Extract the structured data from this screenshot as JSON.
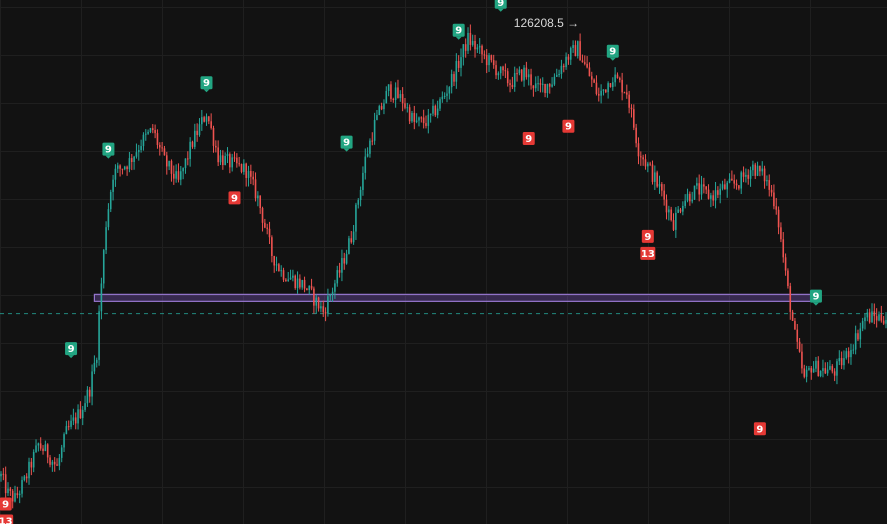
{
  "chart_data": {
    "type": "candlestick",
    "title": "",
    "xlabel": "",
    "ylabel": "",
    "ylim": [
      99000,
      128500
    ],
    "x_count": 380,
    "grid": true,
    "colors": {
      "background": "#121212",
      "grid": "#1f1f1f",
      "up": "#26a69a",
      "down": "#ef5350",
      "sell_marker": "#22a582",
      "buy_marker": "#e53935",
      "zone_fill": "#7e57c2",
      "zone_border": "#9575cd",
      "dashed_line": "#26a69a"
    },
    "anchors": [
      [
        0,
        101500
      ],
      [
        3,
        100500
      ],
      [
        6,
        100200
      ],
      [
        10,
        101200
      ],
      [
        16,
        103300
      ],
      [
        20,
        102800
      ],
      [
        24,
        102000
      ],
      [
        28,
        104000
      ],
      [
        34,
        105200
      ],
      [
        38,
        106500
      ],
      [
        41,
        108600
      ],
      [
        42,
        110800
      ],
      [
        45,
        116000
      ],
      [
        48,
        118800
      ],
      [
        55,
        119500
      ],
      [
        60,
        120600
      ],
      [
        65,
        121300
      ],
      [
        70,
        119500
      ],
      [
        76,
        118300
      ],
      [
        82,
        120600
      ],
      [
        88,
        122300
      ],
      [
        93,
        119800
      ],
      [
        98,
        119400
      ],
      [
        105,
        119000
      ],
      [
        110,
        117400
      ],
      [
        116,
        114200
      ],
      [
        120,
        113200
      ],
      [
        126,
        112700
      ],
      [
        130,
        112400
      ],
      [
        138,
        110900
      ],
      [
        145,
        113200
      ],
      [
        150,
        115200
      ],
      [
        156,
        119600
      ],
      [
        160,
        121600
      ],
      [
        166,
        123600
      ],
      [
        172,
        123000
      ],
      [
        177,
        121700
      ],
      [
        183,
        121800
      ],
      [
        190,
        123300
      ],
      [
        195,
        124800
      ],
      [
        200,
        126500
      ],
      [
        206,
        125600
      ],
      [
        212,
        124800
      ],
      [
        218,
        124000
      ],
      [
        224,
        124600
      ],
      [
        230,
        123600
      ],
      [
        236,
        124100
      ],
      [
        242,
        125400
      ],
      [
        247,
        126000
      ],
      [
        250,
        125000
      ],
      [
        256,
        123200
      ],
      [
        262,
        124400
      ],
      [
        268,
        123500
      ],
      [
        273,
        120200
      ],
      [
        278,
        119000
      ],
      [
        283,
        117700
      ],
      [
        288,
        116000
      ],
      [
        292,
        117300
      ],
      [
        298,
        117900
      ],
      [
        304,
        117500
      ],
      [
        310,
        118000
      ],
      [
        316,
        118300
      ],
      [
        322,
        119200
      ],
      [
        327,
        118600
      ],
      [
        332,
        117000
      ],
      [
        336,
        113000
      ],
      [
        340,
        109500
      ],
      [
        344,
        107000
      ],
      [
        347,
        107800
      ],
      [
        352,
        107600
      ],
      [
        357,
        107500
      ],
      [
        362,
        108400
      ],
      [
        366,
        109400
      ],
      [
        370,
        110600
      ]
    ],
    "zone": {
      "x_start": 40,
      "x_end": 380,
      "y_low": 111500,
      "y_high": 111900
    },
    "dashed_level": 110800,
    "high_label": {
      "text": "126208.5 →",
      "x_index": 247
    },
    "sell_markers": [
      {
        "label": "9",
        "x_index": 30,
        "y": 108200
      },
      {
        "label": "9",
        "x_index": 46,
        "y": 119600
      },
      {
        "label": "9",
        "x_index": 88,
        "y": 123400
      },
      {
        "label": "9",
        "x_index": 148,
        "y": 120000
      },
      {
        "label": "9",
        "x_index": 196,
        "y": 126400
      },
      {
        "label": "9",
        "x_index": 214,
        "y": 128000
      },
      {
        "label": "9",
        "x_index": 262,
        "y": 125200
      },
      {
        "label": "9",
        "x_index": 349,
        "y": 111200
      }
    ],
    "buy_markers": [
      {
        "labels": [
          "9",
          "13"
        ],
        "x_index": 2,
        "y": 100400
      },
      {
        "labels": [
          "9"
        ],
        "x_index": 100,
        "y": 117900
      },
      {
        "labels": [
          "9"
        ],
        "x_index": 226,
        "y": 121300
      },
      {
        "labels": [
          "9"
        ],
        "x_index": 243,
        "y": 122000
      },
      {
        "labels": [
          "9",
          "13"
        ],
        "x_index": 277,
        "y": 115700
      },
      {
        "labels": [
          "9"
        ],
        "x_index": 325,
        "y": 104700
      }
    ]
  }
}
